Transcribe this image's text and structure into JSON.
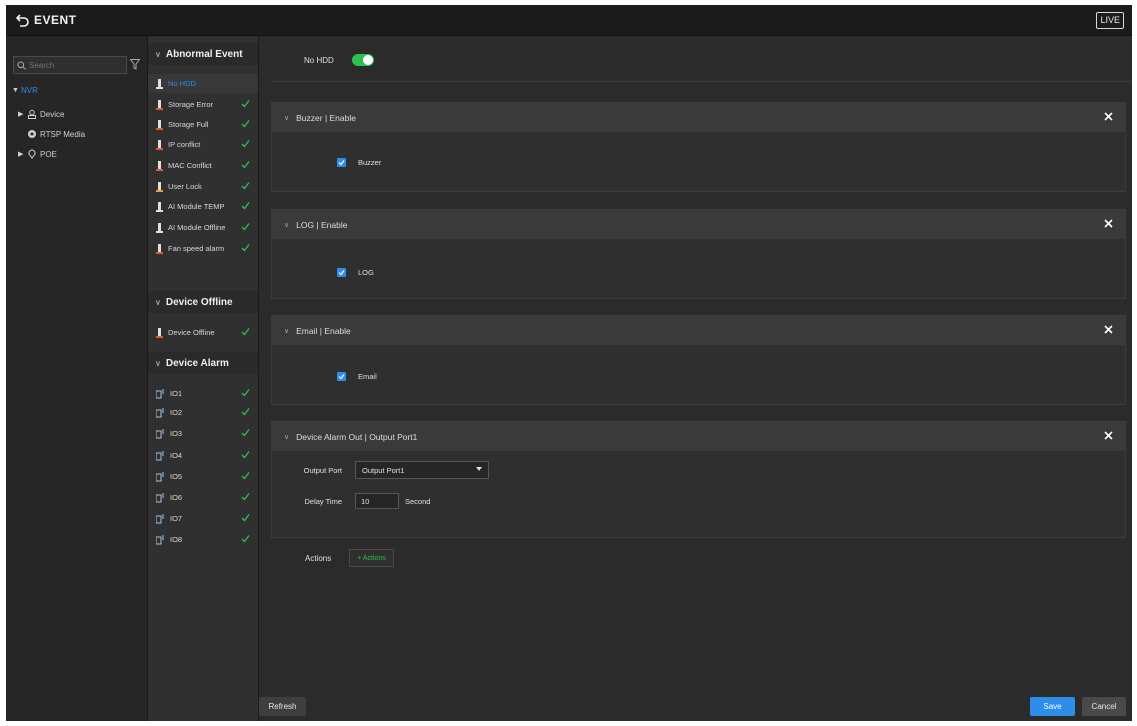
{
  "topbar": {
    "title": "EVENT",
    "live_label": "LIVE"
  },
  "tree": {
    "search_placeholder": "Search",
    "root_label": "NVR",
    "items": [
      {
        "label": "Device",
        "icon": "device-icon"
      },
      {
        "label": "RTSP Media",
        "icon": "media-icon"
      },
      {
        "label": "POE",
        "icon": "poe-icon"
      }
    ]
  },
  "events": {
    "groups": [
      {
        "title": "Abnormal Event",
        "items": [
          "No HDD",
          "Storage Error",
          "Storage Full",
          "IP conflict",
          "MAC Conflict",
          "User Lock",
          "AI Module TEMP",
          "AI Module Offline",
          "Fan speed alarm"
        ]
      },
      {
        "title": "Device Offline",
        "items": [
          "Device Offline"
        ]
      },
      {
        "title": "Device Alarm",
        "items": [
          "IO1",
          "IO2",
          "IO3",
          "IO4",
          "IO5",
          "IO6",
          "IO7",
          "IO8"
        ]
      }
    ]
  },
  "main": {
    "nohdd_label": "No HDD",
    "nohdd_enabled": true,
    "panels": {
      "buzzer": {
        "title": "Buzzer | Enable",
        "checkbox_label": "Buzzer",
        "checked": true
      },
      "log": {
        "title": "LOG | Enable",
        "checkbox_label": "LOG",
        "checked": true
      },
      "email": {
        "title": "Email | Enable",
        "checkbox_label": "Email",
        "checked": true
      },
      "alarm_out": {
        "title": "Device Alarm Out | Output Port1",
        "output_port_label": "Output Port",
        "output_port_value": "Output Port1",
        "delay_label": "Delay Time",
        "delay_value": "10",
        "delay_unit": "Second"
      }
    },
    "actions_label": "Actions",
    "add_action_label": "+ Actions"
  },
  "footer": {
    "refresh_label": "Refresh",
    "save_label": "Save",
    "cancel_label": "Cancel"
  },
  "colors": {
    "accent_blue": "#2c8eea",
    "check_green": "#2fbf4f",
    "toggle_green": "#2fbf4f"
  }
}
